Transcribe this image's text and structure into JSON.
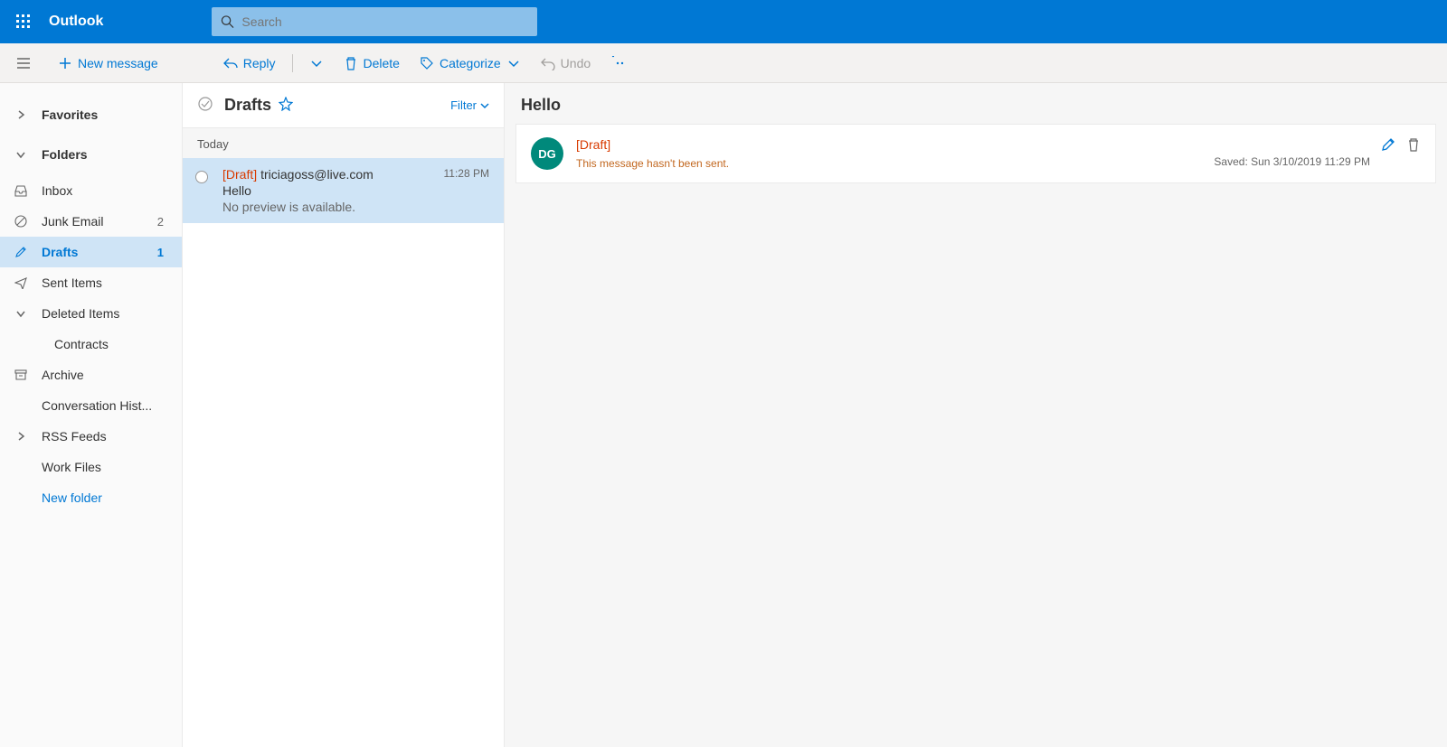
{
  "header": {
    "app_name": "Outlook",
    "search_placeholder": "Search"
  },
  "commands": {
    "new_message": "New message",
    "reply": "Reply",
    "delete": "Delete",
    "categorize": "Categorize",
    "undo": "Undo"
  },
  "sidebar": {
    "favorites": "Favorites",
    "folders_label": "Folders",
    "new_folder": "New folder",
    "folders": [
      {
        "name": "Inbox",
        "count": "",
        "icon": "inbox"
      },
      {
        "name": "Junk Email",
        "count": "2",
        "icon": "junk"
      },
      {
        "name": "Drafts",
        "count": "1",
        "icon": "draft",
        "selected": true
      },
      {
        "name": "Sent Items",
        "count": "",
        "icon": "sent"
      },
      {
        "name": "Deleted Items",
        "count": "",
        "icon": "chev"
      },
      {
        "name": "Contracts",
        "count": "",
        "icon": "",
        "indent": true
      },
      {
        "name": "Archive",
        "count": "",
        "icon": "archive"
      },
      {
        "name": "Conversation Hist...",
        "count": "",
        "icon": ""
      },
      {
        "name": "RSS Feeds",
        "count": "",
        "icon": "chevr"
      },
      {
        "name": "Work Files",
        "count": "",
        "icon": ""
      }
    ]
  },
  "list": {
    "title": "Drafts",
    "filter": "Filter",
    "group": "Today",
    "item": {
      "draft": "[Draft]",
      "to": "triciagoss@live.com",
      "time": "11:28 PM",
      "subject": "Hello",
      "preview": "No preview is available."
    }
  },
  "reading": {
    "subject": "Hello",
    "avatar": "DG",
    "draft": "[Draft]",
    "not_sent": "This message hasn't been sent.",
    "saved": "Saved: Sun 3/10/2019 11:29 PM"
  }
}
